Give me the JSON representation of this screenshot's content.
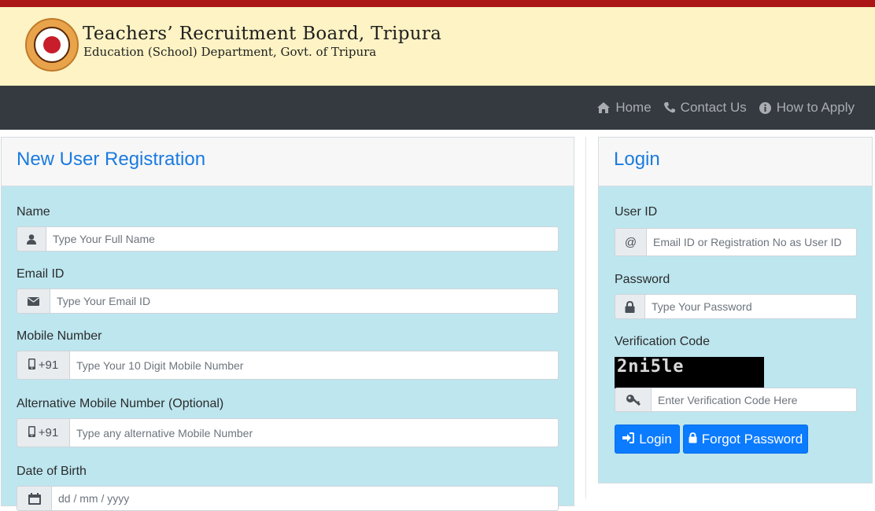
{
  "header": {
    "title": "Teachers’ Recruitment Board, Tripura",
    "subtitle": "Education (School) Department, Govt. of Tripura"
  },
  "nav": {
    "items": [
      {
        "label": "Home",
        "icon": "home-icon"
      },
      {
        "label": "Contact Us",
        "icon": "phone-icon"
      },
      {
        "label": "How to Apply",
        "icon": "info-circle-icon"
      }
    ]
  },
  "registration": {
    "title": "New User Registration",
    "name_label": "Name",
    "name_placeholder": "Type Your Full Name",
    "email_label": "Email ID",
    "email_placeholder": "Type Your Email ID",
    "mobile_label": "Mobile Number",
    "mobile_prefix": "+91",
    "mobile_placeholder": "Type Your 10 Digit Mobile Number",
    "alt_mobile_label": "Alternative Mobile Number (Optional)",
    "alt_mobile_prefix": "+91",
    "alt_mobile_placeholder": "Type any alternative Mobile Number",
    "dob_label": "Date of Birth",
    "dob_placeholder": "dd / mm / yyyy"
  },
  "login": {
    "title": "Login",
    "userid_label": "User ID",
    "userid_addon": "@",
    "userid_placeholder": "Email ID or Registration No as User ID",
    "password_label": "Password",
    "password_placeholder": "Type Your Password",
    "verification_label": "Verification Code",
    "captcha_text": "2ni5le",
    "verification_placeholder": "Enter Verification Code Here",
    "login_button": "Login",
    "forgot_button": "Forgot Password"
  },
  "colors": {
    "top_bar": "#ab1515",
    "header_bg": "#fdf3c4",
    "navbar_bg": "#343a40",
    "card_bg": "#bde6ef",
    "accent": "#0b7bff",
    "title_blue": "#1a7be0"
  }
}
